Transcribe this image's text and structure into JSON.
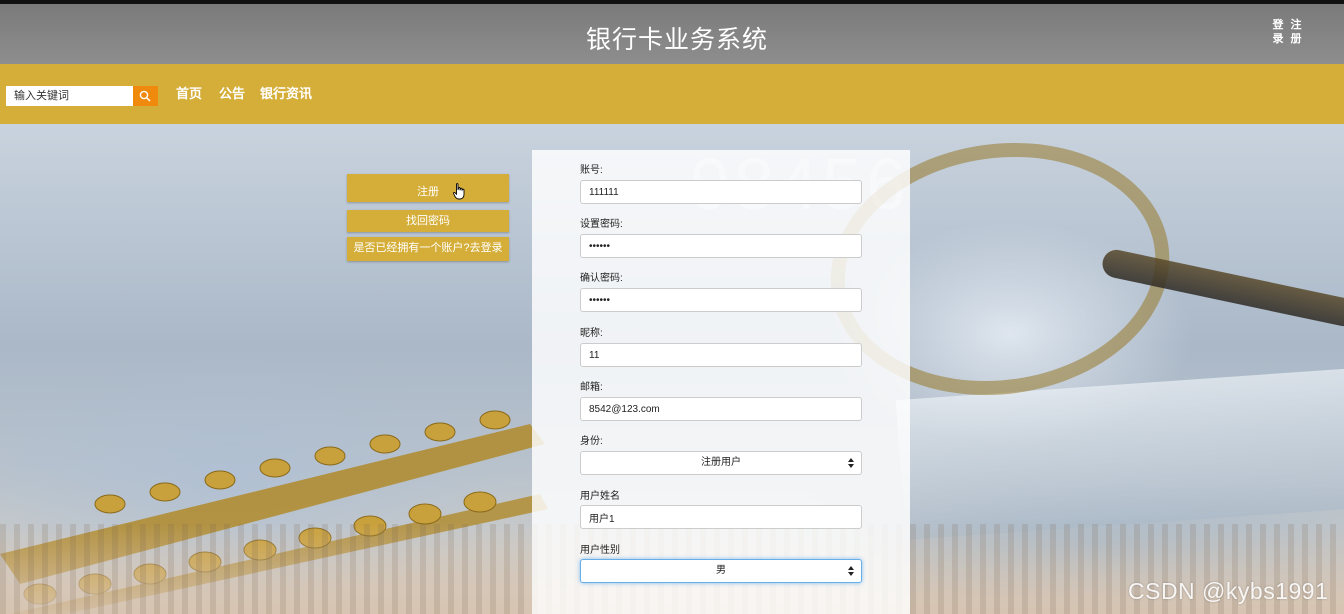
{
  "header": {
    "site_title": "银行卡业务系统",
    "login_link": "登录",
    "register_link": "注册"
  },
  "navbar": {
    "search_placeholder": "输入关键词",
    "items": [
      {
        "label": "首页"
      },
      {
        "label": "公告"
      },
      {
        "label": "银行资讯"
      }
    ]
  },
  "side_actions": {
    "register_button": "注册",
    "find_password_button": "找回密码",
    "goto_login_button": "是否已经拥有一个账户?去登录"
  },
  "form": {
    "fields": [
      {
        "label": "账号:",
        "value": "111111",
        "type": "text"
      },
      {
        "label": "设置密码:",
        "value": "••••••",
        "type": "password"
      },
      {
        "label": "确认密码:",
        "value": "••••••",
        "type": "password"
      },
      {
        "label": "昵称:",
        "value": "11",
        "type": "text"
      },
      {
        "label": "邮箱:",
        "value": "8542@123.com",
        "type": "text"
      },
      {
        "label": "身份:",
        "value": "注册用户",
        "type": "select"
      },
      {
        "label": "用户姓名",
        "value": "用户1",
        "type": "text"
      },
      {
        "label": "用户性别",
        "value": "男",
        "type": "select"
      }
    ]
  },
  "background": {
    "ghost_number": "98456"
  },
  "watermark": "CSDN @kybs1991",
  "colors": {
    "header_gray": "#8a8a8a",
    "nav_gold": "#d4ae38",
    "search_button_orange": "#ef8a0c"
  }
}
